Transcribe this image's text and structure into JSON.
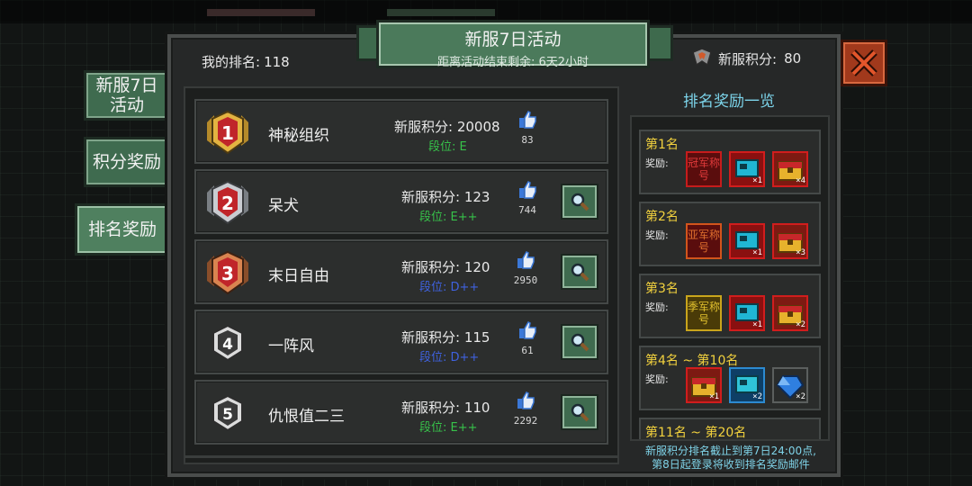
{
  "event": {
    "title": "新服7日活动",
    "countdown": "距离活动结束剩余: 6天2小时"
  },
  "my_rank": {
    "label": "我的排名:",
    "value": "118"
  },
  "my_points": {
    "label": "新服积分:",
    "value": "80"
  },
  "side_tabs": [
    {
      "label": "新服7日活动"
    },
    {
      "label": "积分奖励"
    },
    {
      "label": "排名奖励",
      "active": true
    }
  ],
  "ranking": [
    {
      "rank": "1",
      "name": "神秘组织",
      "score_label": "新服积分:",
      "score": "20008",
      "tier_label": "段位:",
      "tier": "E",
      "tier_color": "#37c24a",
      "likes": "83",
      "has_search": false
    },
    {
      "rank": "2",
      "name": "呆犬",
      "score_label": "新服积分:",
      "score": "123",
      "tier_label": "段位:",
      "tier": "E++",
      "tier_color": "#37c24a",
      "likes": "744",
      "has_search": true
    },
    {
      "rank": "3",
      "name": "末日自由",
      "score_label": "新服积分:",
      "score": "120",
      "tier_label": "段位:",
      "tier": "D++",
      "tier_color": "#3f62e0",
      "likes": "2950",
      "has_search": true
    },
    {
      "rank": "4",
      "name": "一阵风",
      "score_label": "新服积分:",
      "score": "115",
      "tier_label": "段位:",
      "tier": "D++",
      "tier_color": "#3f62e0",
      "likes": "61",
      "has_search": true
    },
    {
      "rank": "5",
      "name": "仇恨值二三",
      "score_label": "新服积分:",
      "score": "110",
      "tier_label": "段位:",
      "tier": "E++",
      "tier_color": "#37c24a",
      "likes": "2292",
      "has_search": true
    }
  ],
  "rewards": {
    "title": "排名奖励一览",
    "reward_label": "奖励:",
    "tiers": [
      {
        "rank": "第1名",
        "items": [
          {
            "kind": "title",
            "text": "冠军称号",
            "color": "#e03a3a"
          },
          {
            "kind": "device",
            "qty": "×1"
          },
          {
            "kind": "chest",
            "qty": "×4"
          }
        ]
      },
      {
        "rank": "第2名",
        "items": [
          {
            "kind": "title",
            "text": "亚军称号",
            "color": "#e0702e"
          },
          {
            "kind": "device",
            "qty": "×1"
          },
          {
            "kind": "chest",
            "qty": "×3"
          }
        ]
      },
      {
        "rank": "第3名",
        "items": [
          {
            "kind": "title",
            "text": "季军称号",
            "color": "#e3c22e"
          },
          {
            "kind": "device",
            "qty": "×1"
          },
          {
            "kind": "chest",
            "qty": "×2"
          }
        ]
      },
      {
        "rank": "第4名 ~ 第10名",
        "items": [
          {
            "kind": "chest",
            "qty": "×1"
          },
          {
            "kind": "device-blue",
            "qty": "×2"
          },
          {
            "kind": "gem",
            "qty": "×2"
          }
        ]
      },
      {
        "rank": "第11名 ~ 第20名",
        "items": []
      }
    ],
    "note_line1": "新服积分排名截止到第7日24:00点,",
    "note_line2": "第8日起登录将收到排名奖励邮件"
  }
}
